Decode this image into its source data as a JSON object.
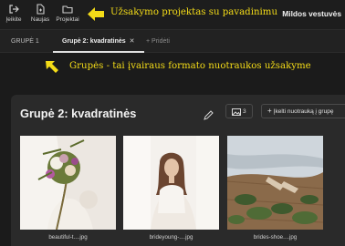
{
  "toolbar": {
    "items": [
      {
        "label": "Įeikite",
        "icon": "sign-in-icon"
      },
      {
        "label": "Naujas",
        "icon": "new-project-icon"
      },
      {
        "label": "Projektai",
        "icon": "folder-icon"
      }
    ],
    "project_name": "Mildos vestuvės"
  },
  "callouts": {
    "top": "Užsakymo projektas su pavadinimu",
    "groups": "Grupės - tai įvairaus formato nuotraukos užsakyme",
    "color": "#f4dc18"
  },
  "tabs": {
    "items": [
      {
        "label": "GRUPĖ 1"
      },
      {
        "label": "Grupė 2: kvadratinės",
        "active": true,
        "close": "✕"
      }
    ],
    "add_label": "+ Pridėti"
  },
  "group": {
    "title": "Grupė 2: kvadratinės",
    "photo_count": "3",
    "upload_label": "Įkelti nuotrauką į grupę",
    "photos": [
      {
        "filename": "beautiful-t....jpg"
      },
      {
        "filename": "brideyoung-....jpg"
      },
      {
        "filename": "brides-shoe....jpg"
      }
    ]
  }
}
